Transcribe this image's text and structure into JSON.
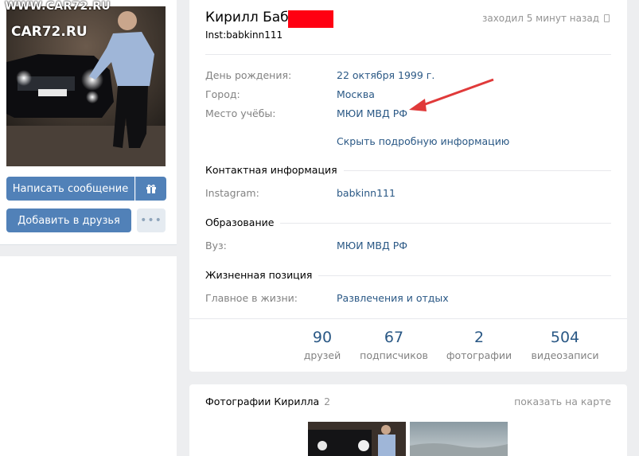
{
  "watermark": {
    "site": "WWW.CAR72.RU",
    "logo": "CAR72.RU"
  },
  "profile": {
    "name": "Кирилл Баб",
    "status": "Inst:babkinn111",
    "online": "заходил 5 минут назад"
  },
  "actions": {
    "message": "Написать сообщение",
    "add_friend": "Добавить в друзья",
    "more": "•••"
  },
  "info": {
    "birthday_label": "День рождения:",
    "birthday": "22 октября 1999 г.",
    "city_label": "Город:",
    "city": "Москва",
    "study_label": "Место учёбы:",
    "study": "МЮИ МВД РФ",
    "toggle": "Скрыть подробную информацию"
  },
  "contacts": {
    "heading": "Контактная информация",
    "instagram_label": "Instagram:",
    "instagram": "babkinn111"
  },
  "education": {
    "heading": "Образование",
    "uni_label": "Вуз:",
    "uni": "МЮИ МВД РФ"
  },
  "life": {
    "heading": "Жизненная позиция",
    "main_label": "Главное в жизни:",
    "main": "Развлечения и отдых"
  },
  "counters": [
    {
      "num": "90",
      "label": "друзей"
    },
    {
      "num": "67",
      "label": "подписчиков"
    },
    {
      "num": "2",
      "label": "фотографии"
    },
    {
      "num": "504",
      "label": "видеозаписи"
    }
  ],
  "photos": {
    "title": "Фотографии Кирилла",
    "count": "2",
    "map_link": "показать на карте"
  },
  "colors": {
    "accent": "#5181b8",
    "link": "#2a5885",
    "arrow": "#e03a3a",
    "redaction": "#ff0012"
  }
}
